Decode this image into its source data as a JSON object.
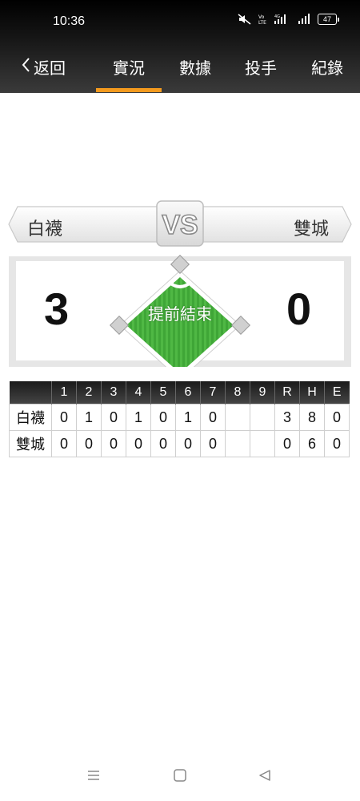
{
  "status_bar": {
    "time": "10:36",
    "icons": [
      "mute-icon",
      "volte-icon",
      "signal-4g-icon",
      "signal-bars-icon"
    ],
    "battery": "47"
  },
  "nav": {
    "back_label": "返回",
    "tabs": [
      {
        "label": "實況",
        "active": true
      },
      {
        "label": "數據",
        "active": false
      },
      {
        "label": "投手",
        "active": false
      },
      {
        "label": "紀錄",
        "active": false
      }
    ],
    "accent_color": "#f39a1e"
  },
  "matchup": {
    "away_team": "白襪",
    "home_team": "雙城",
    "vs_label": "VS"
  },
  "score": {
    "away": "3",
    "home": "0",
    "status": "提前結束"
  },
  "linescore": {
    "headers": [
      "1",
      "2",
      "3",
      "4",
      "5",
      "6",
      "7",
      "8",
      "9",
      "R",
      "H",
      "E"
    ],
    "rows": [
      {
        "team": "白襪",
        "cells": [
          "0",
          "1",
          "0",
          "1",
          "0",
          "1",
          "0",
          "",
          "",
          "3",
          "8",
          "0"
        ]
      },
      {
        "team": "雙城",
        "cells": [
          "0",
          "0",
          "0",
          "0",
          "0",
          "0",
          "0",
          "",
          "",
          "0",
          "6",
          "0"
        ]
      }
    ]
  },
  "system_nav": [
    "menu-icon",
    "home-icon",
    "back-triangle-icon"
  ]
}
